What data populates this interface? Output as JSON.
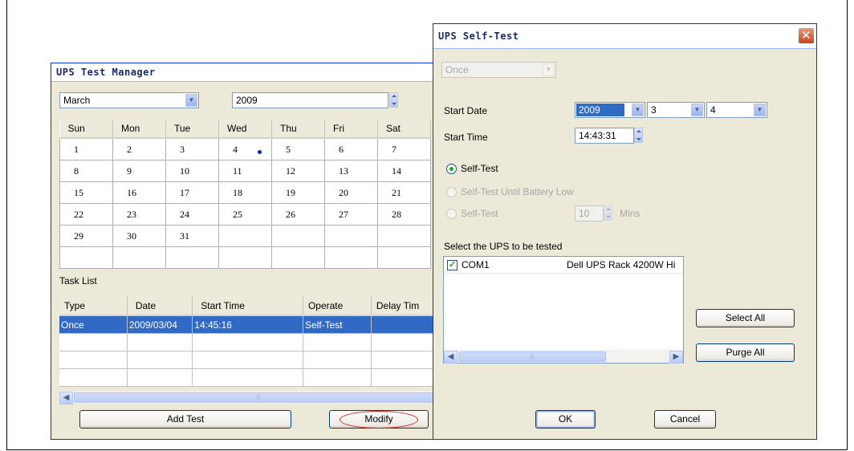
{
  "manager": {
    "title": "UPS Test Manager",
    "month": "March",
    "year": "2009",
    "weekdays": [
      "Sun",
      "Mon",
      "Tue",
      "Wed",
      "Thu",
      "Fri",
      "Sat"
    ],
    "weeks": [
      [
        "1",
        "2",
        "3",
        "4",
        "5",
        "6",
        "7"
      ],
      [
        "8",
        "9",
        "10",
        "11",
        "12",
        "13",
        "14"
      ],
      [
        "15",
        "16",
        "17",
        "18",
        "19",
        "20",
        "21"
      ],
      [
        "22",
        "23",
        "24",
        "25",
        "26",
        "27",
        "28"
      ],
      [
        "29",
        "30",
        "31",
        "",
        "",
        "",
        ""
      ],
      [
        "",
        "",
        "",
        "",
        "",
        "",
        ""
      ]
    ],
    "task_list_label": "Task List",
    "task_columns": [
      "Type",
      "Date",
      "Start Time",
      "Operate",
      "Delay Tim"
    ],
    "tasks": [
      {
        "type": "Once",
        "date": "2009/03/04",
        "start_time": "14:45:16",
        "operate": "Self-Test",
        "delay": ""
      }
    ],
    "add_test_label": "Add Test",
    "modify_label": "Modify"
  },
  "dialog": {
    "title": "UPS Self-Test",
    "frequency": "Once",
    "start_date_label": "Start Date",
    "start_date_year": "2009",
    "start_date_month": "3",
    "start_date_day": "4",
    "start_time_label": "Start Time",
    "start_time_value": "14:43:31",
    "option_self_test": "Self-Test",
    "option_until_low": "Self-Test Until Battery Low",
    "option_timed": "Self-Test",
    "timed_minutes": "10",
    "minutes_unit": "Mins",
    "select_ups_label": "Select the UPS to be tested",
    "ups_list": [
      {
        "port": "COM1",
        "model": "Dell UPS Rack 4200W Hi",
        "checked": true
      }
    ],
    "select_all_label": "Select All",
    "purge_all_label": "Purge All",
    "ok_label": "OK",
    "cancel_label": "Cancel"
  }
}
